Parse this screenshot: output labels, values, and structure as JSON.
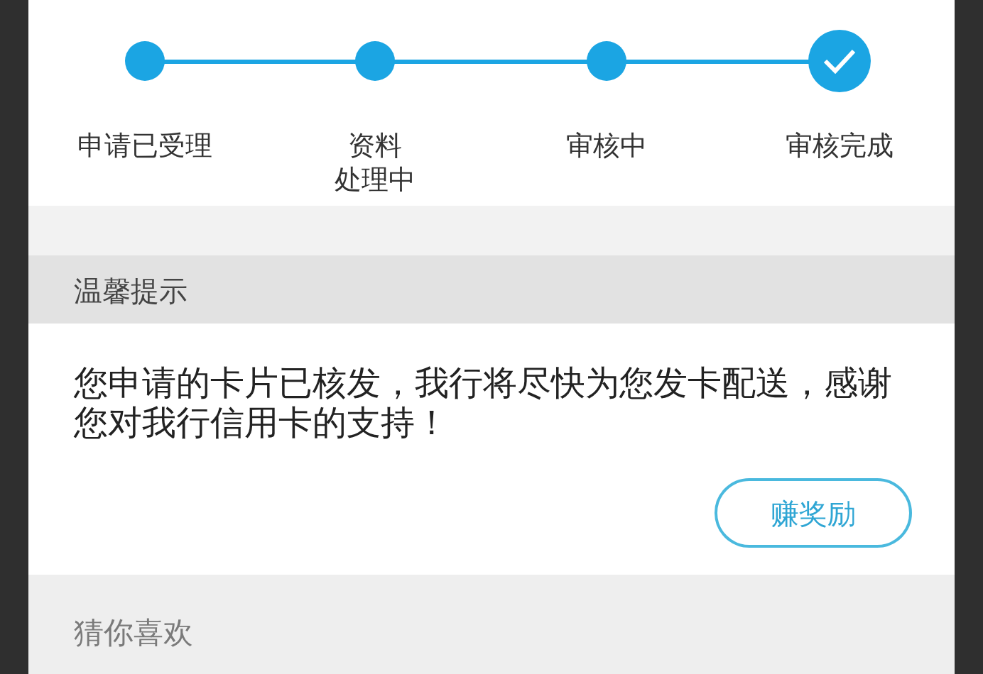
{
  "steps": [
    {
      "lines": [
        "申请已受理"
      ],
      "checked": false
    },
    {
      "lines": [
        "资料",
        "处理中"
      ],
      "checked": false
    },
    {
      "lines": [
        "审核中"
      ],
      "checked": false
    },
    {
      "lines": [
        "审核完成"
      ],
      "checked": true
    }
  ],
  "notice": {
    "title": "温馨提示",
    "message": "您申请的卡片已核发，我行将尽快为您发卡配送，感谢您对我行信用卡的支持！",
    "button": "赚奖励"
  },
  "recommend": {
    "title": "猜你喜欢"
  }
}
